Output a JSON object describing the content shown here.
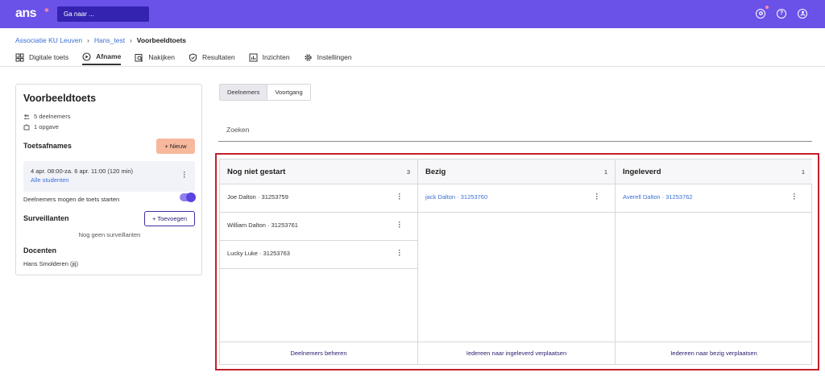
{
  "topbar": {
    "logo": "ans",
    "search_placeholder": "Ga naar ...",
    "icons": [
      "notifications-icon",
      "help-icon",
      "account-icon"
    ],
    "brand_color": "#6a52e8"
  },
  "breadcrumb": {
    "items": [
      "Associatie KU Leuven",
      "Hans_test"
    ],
    "current": "Voorbeeldtoets"
  },
  "tabs": [
    {
      "label": "Digitale toets",
      "icon": "grid-icon",
      "active": false
    },
    {
      "label": "Afname",
      "icon": "play-circle-icon",
      "active": true
    },
    {
      "label": "Nakijken",
      "icon": "review-icon",
      "active": false
    },
    {
      "label": "Resultaten",
      "icon": "shield-check-icon",
      "active": false
    },
    {
      "label": "Inzichten",
      "icon": "chart-icon",
      "active": false
    },
    {
      "label": "Instellingen",
      "icon": "gear-icon",
      "active": false
    }
  ],
  "sidebar": {
    "title": "Voorbeeldtoets",
    "participants": "5 deelnemers",
    "assignments": "1 opgave",
    "afnames_heading": "Toetsafnames",
    "new_button": "+ Nieuw",
    "afname": {
      "date": "4 apr. 08:00-za. 6 apr. 11:00 (120 min)",
      "students_link": "Alle studenten"
    },
    "toggle_label": "Deelnemers mogen de toets starten",
    "toggle_on": true,
    "surveillants_heading": "Surveillanten",
    "add_button": "+ Toevoegen",
    "no_surveillants": "Nog geen surveillanten",
    "docenten_heading": "Docenten",
    "docent": "Hans Smolderen (jij)"
  },
  "segment": {
    "options": [
      "Deelnemers",
      "Voortgang"
    ],
    "active": "Deelnemers"
  },
  "search": {
    "placeholder": "Zoeken"
  },
  "board": {
    "columns": [
      {
        "title": "Nog niet gestart",
        "count": "3",
        "rows": [
          "Joe Dalton · 31253759",
          "William Dalton · 31253761",
          "Lucky Luke · 31253763"
        ],
        "row_style": "dark",
        "footer": "Deelnemers beheren"
      },
      {
        "title": "Bezig",
        "count": "1",
        "rows": [
          "jack Dalton · 31253760"
        ],
        "row_style": "blue",
        "footer": "Iedereen naar ingeleverd verplaatsen"
      },
      {
        "title": "Ingeleverd",
        "count": "1",
        "rows": [
          "Averell Dalton · 31253762"
        ],
        "row_style": "blue",
        "footer": "Iedereen naar bezig verplaatsen"
      }
    ],
    "highlight_color": "#c41e2a"
  }
}
